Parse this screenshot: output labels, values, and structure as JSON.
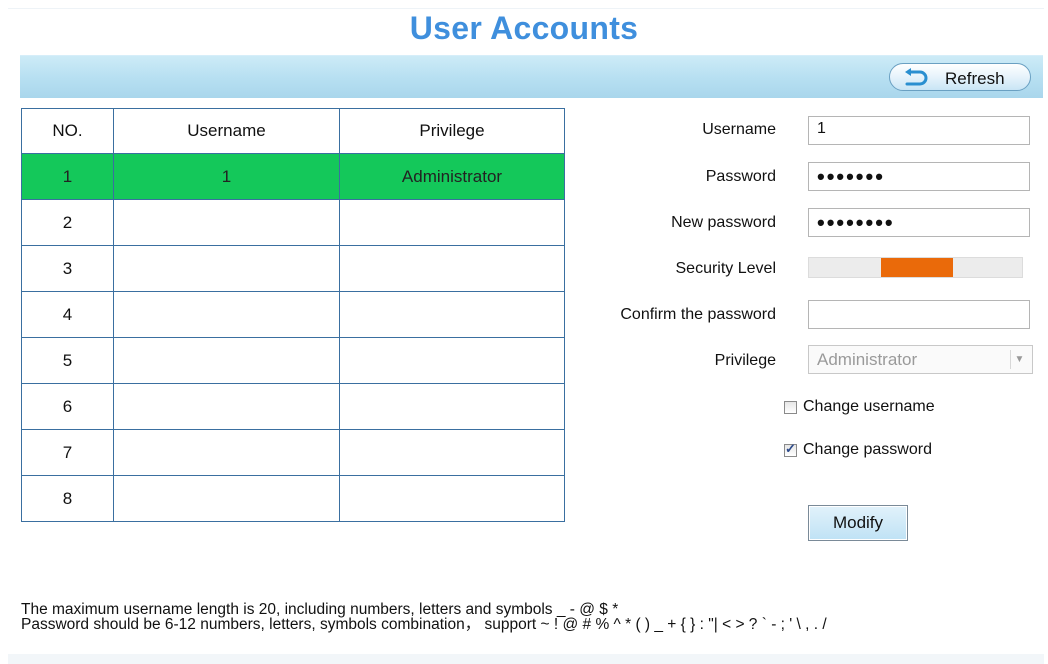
{
  "page": {
    "title": "User Accounts"
  },
  "toolbar": {
    "refresh_label": "Refresh"
  },
  "table": {
    "headers": [
      "NO.",
      "Username",
      "Privilege"
    ],
    "rows": [
      {
        "no": "1",
        "username": "1",
        "privilege": "Administrator"
      },
      {
        "no": "2",
        "username": "",
        "privilege": ""
      },
      {
        "no": "3",
        "username": "",
        "privilege": ""
      },
      {
        "no": "4",
        "username": "",
        "privilege": ""
      },
      {
        "no": "5",
        "username": "",
        "privilege": ""
      },
      {
        "no": "6",
        "username": "",
        "privilege": ""
      },
      {
        "no": "7",
        "username": "",
        "privilege": ""
      },
      {
        "no": "8",
        "username": "",
        "privilege": ""
      }
    ],
    "selected_row_color": "#14c85a"
  },
  "form": {
    "username_label": "Username",
    "username_value": "1",
    "password_label": "Password",
    "password_value": "•••••••",
    "new_password_label": "New password",
    "new_password_value": "••••••••",
    "security_label": "Security Level",
    "security_level_fill_color": "#ea6a0a",
    "confirm_label": "Confirm the password",
    "confirm_value": "",
    "privilege_label": "Privilege",
    "privilege_value": "Administrator",
    "change_username_label": "Change username",
    "change_username_checked": false,
    "change_password_label": "Change password",
    "change_password_checked": true,
    "modify_label": "Modify"
  },
  "notes": {
    "line1": "The maximum username length is 20, including numbers, letters and symbols _ - @ $ *",
    "line2": "Password should be 6-12 numbers, letters, symbols combination， support ~ ! @ # % ^ * ( ) _ + { } : \"| < > ? ` - ; ' \\ , . /"
  },
  "icons": {
    "refresh": "refresh-arrow-icon",
    "dropdown": "chevron-down-icon"
  },
  "colors": {
    "title": "#3f8fdd",
    "toolbar": "#b6dff1"
  }
}
